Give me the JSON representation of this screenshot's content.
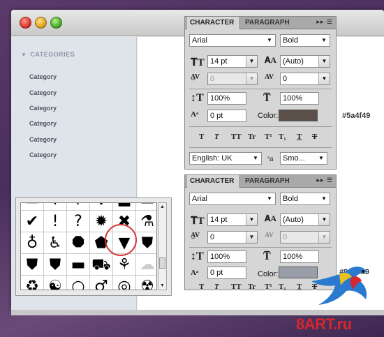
{
  "sidebar": {
    "header": "CATEGORIES",
    "items": [
      "Category",
      "Category",
      "Category",
      "Category",
      "Category",
      "Category"
    ]
  },
  "panel1": {
    "tab_active": "CHARACTER",
    "tab_inactive": "PARAGRAPH",
    "menu_glyph": "▸▸ ☰",
    "font_family": "Arial",
    "font_style": "Bold",
    "font_size": "14 pt",
    "leading": "(Auto)",
    "kerning": "0",
    "tracking": "0",
    "vertical_scale": "100%",
    "horizontal_scale": "100%",
    "baseline_shift": "0 pt",
    "color_label": "Color:",
    "color_hex": "#5a4f49",
    "language": "English: UK",
    "antialias": "Smo...",
    "aa_glyph": "ᵃa"
  },
  "panel2": {
    "tab_active": "CHARACTER",
    "tab_inactive": "PARAGRAPH",
    "menu_glyph": "▸▸ ☰",
    "font_family": "Arial",
    "font_style": "Bold",
    "font_size": "14 pt",
    "leading": "(Auto)",
    "kerning": "0",
    "tracking": "0",
    "vertical_scale": "100%",
    "horizontal_scale": "100%",
    "baseline_shift": "0 pt",
    "color_label": "Color:",
    "color_hex": "#999ea9"
  },
  "style_buttons": [
    "T",
    "T",
    "TT",
    "Tr",
    "T¹",
    "T₁",
    "T",
    "T"
  ],
  "glyph_rows": [
    [
      "▭",
      "!",
      "?",
      "✱",
      "■",
      "▬"
    ],
    [
      "✔",
      "!",
      "?",
      "✹",
      "✖",
      "⚗"
    ],
    [
      "♁",
      "♿",
      "⯃",
      "⬟",
      "▼",
      "⛊"
    ],
    [
      "⛊",
      "⛊",
      "▬",
      "⛟",
      "⚘",
      "☁"
    ],
    [
      "♻",
      "☯",
      "○",
      "♂",
      "◎",
      "☢"
    ]
  ],
  "watermark": "8ART.ru",
  "colors": {
    "swatch1": "#5a4f49",
    "swatch2": "#999ea9",
    "sidebar": "#dfe4ea",
    "panel": "#d6d6d6",
    "highlight_circle": "#d23a36",
    "watermark": "#d9262c"
  }
}
